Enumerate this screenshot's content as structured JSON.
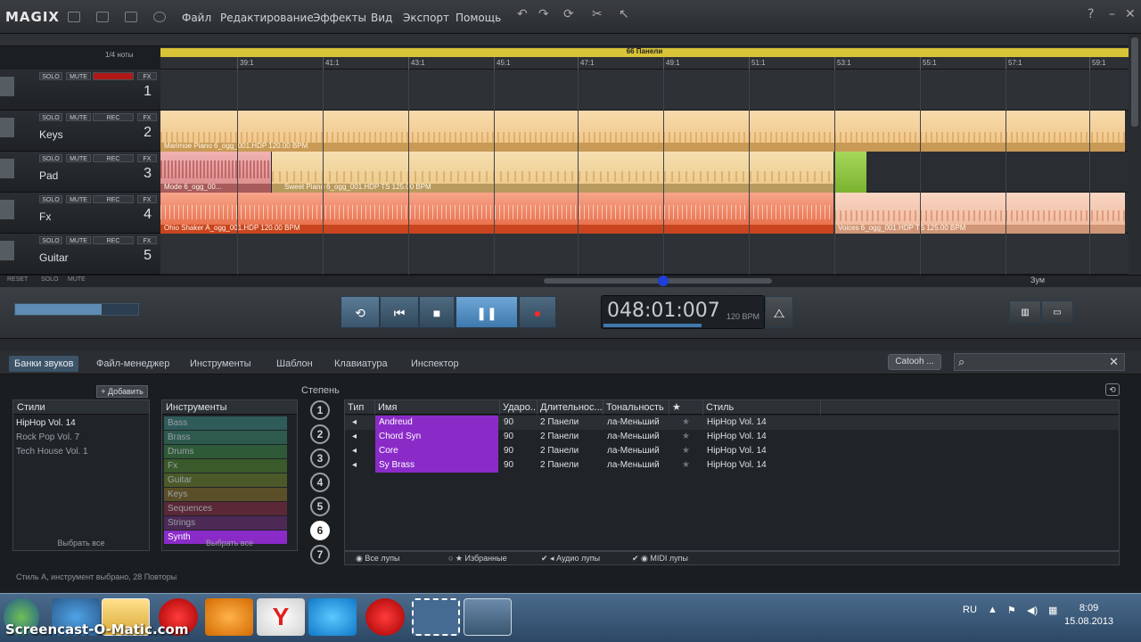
{
  "menubar": {
    "logo": "MAGIX",
    "items": [
      "Файл",
      "Редактирование",
      "Эффекты",
      "Вид",
      "Экспорт",
      "Помощь"
    ]
  },
  "timeline": {
    "note_label": "1/4 ноты",
    "length_label": "66 Панели",
    "ticks": [
      "39:1",
      "41:1",
      "43:1",
      "45:1",
      "47:1",
      "49:1",
      "51:1",
      "53:1",
      "55:1",
      "57:1",
      "59:1"
    ]
  },
  "tracks": [
    {
      "name": "",
      "number": "1",
      "solo": "SOLO",
      "mute": "MUTE",
      "rec": "REC",
      "fx": "FX"
    },
    {
      "name": "Keys",
      "number": "2",
      "solo": "SOLO",
      "mute": "MUTE",
      "rec": "REC",
      "fx": "FX"
    },
    {
      "name": "Pad",
      "number": "3",
      "solo": "SOLO",
      "mute": "MUTE",
      "rec": "REC",
      "fx": "FX"
    },
    {
      "name": "Fx",
      "number": "4",
      "solo": "SOLO",
      "mute": "MUTE",
      "rec": "REC",
      "fx": "FX"
    },
    {
      "name": "Guitar",
      "number": "5",
      "solo": "SOLO",
      "mute": "MUTE",
      "rec": "REC",
      "fx": "FX"
    }
  ],
  "footer_buttons": {
    "reset": "RESET",
    "solo": "SOLO",
    "mute": "MUTE"
  },
  "clips": {
    "keys": "Marimoe Piano 6_ogg_001.HDP  120.00 BPM",
    "pad_a": "Mode 6_ogg_00...",
    "pad_b": "Sweet Piano 6_ogg_001.HDP  TS  125.00 BPM",
    "fx_a": "Ohio Shaker A_ogg_001.HDP  120.00 BPM",
    "fx_b": "Voices 6_ogg_001.HDP  TS  125.00 BPM"
  },
  "zoom_label": "Зум",
  "transport": {
    "time": "048:01:007",
    "tempo": "120 BPM"
  },
  "tabs": [
    "Банки звуков",
    "Файл-менеджер",
    "Инструменты",
    "Шаблон",
    "Клавиатура",
    "Инспектор"
  ],
  "search_button": "Сatooh ...",
  "styles": {
    "header": "Стили",
    "add_label": "Добавить",
    "items": [
      "HipHop Vol. 14",
      "Rock Pop Vol. 7",
      "Tech House Vol. 1"
    ],
    "footer": "Выбрать все"
  },
  "instruments": {
    "header": "Инструменты",
    "items": [
      {
        "label": "Bass",
        "color": "#2f5b5a"
      },
      {
        "label": "Brass",
        "color": "#2e5a4e"
      },
      {
        "label": "Drums",
        "color": "#2f5a38"
      },
      {
        "label": "Fx",
        "color": "#3a5a2c"
      },
      {
        "label": "Guitar",
        "color": "#4c5a2a"
      },
      {
        "label": "Keys",
        "color": "#5a4f28"
      },
      {
        "label": "Sequences",
        "color": "#5a2836"
      },
      {
        "label": "Strings",
        "color": "#4c2a55"
      },
      {
        "label": "Synth",
        "color": "#8a2bc8"
      }
    ],
    "footer": "Выбрать все"
  },
  "degree": {
    "label": "Степень",
    "items": [
      "1",
      "2",
      "3",
      "4",
      "5",
      "6",
      "7"
    ],
    "active": "6"
  },
  "loops": {
    "columns": [
      "Тип",
      "Имя",
      "Ударо...",
      "Длительнос...",
      "Тональность",
      "★",
      "Стиль"
    ],
    "rows": [
      {
        "name": "Andreud",
        "bpm": "90",
        "length": "2 Панели",
        "key": "ла-Меньший",
        "style": "HipHop Vol. 14"
      },
      {
        "name": "Chord Syn",
        "bpm": "90",
        "length": "2 Панели",
        "key": "ла-Меньший",
        "style": "HipHop Vol. 14"
      },
      {
        "name": "Core",
        "bpm": "90",
        "length": "2 Панели",
        "key": "ла-Меньший",
        "style": "HipHop Vol. 14"
      },
      {
        "name": "Sy Brass",
        "bpm": "90",
        "length": "2 Панели",
        "key": "ла-Меньший",
        "style": "HipHop Vol. 14"
      }
    ],
    "filters": {
      "all": "Все лупы",
      "favorites": "Избранные",
      "audio": "Аудио лупы",
      "midi": "MIDI лупы"
    }
  },
  "status_line": "Стиль А, инструмент выбрано, 28 Повторы",
  "taskbar": {
    "lang": "RU",
    "time": "8:09",
    "date": "15.08.2013"
  },
  "watermark": "Screencast-O-Matic.com",
  "colors": {
    "clip_keys": "#f3c98e",
    "clip_pad_pink": "#e79a9a",
    "clip_fx": "#ec6a43",
    "clip_green": "#8dbd3a",
    "accent_blue": "#3d5468",
    "synth_purple": "#8a2bc8"
  }
}
